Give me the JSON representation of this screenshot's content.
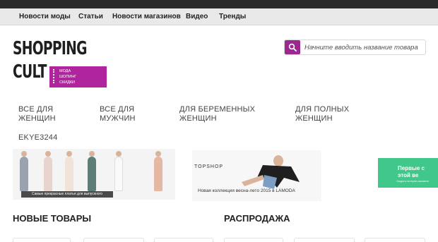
{
  "nav": {
    "items": [
      "Новости моды",
      "Статьи",
      "Новости магазинов",
      "Видео",
      "Тренды"
    ]
  },
  "logo": {
    "line1": "SHOPPING",
    "line2": "CULT",
    "tag": [
      "мода",
      "шопинг",
      "скидки"
    ],
    "accent_color": "#b0259d"
  },
  "search": {
    "placeholder": "Начните вводить название товара",
    "button_icon": "search-icon",
    "button_color": "#9b2a8f"
  },
  "categories": [
    {
      "label": "Все для женщин"
    },
    {
      "label": "Все для мужчин"
    },
    {
      "label": "Для беременных женщин"
    },
    {
      "label": "Для полных женщин"
    },
    {
      "label": "ekye3244"
    }
  ],
  "banners": {
    "b1_caption": "Самые прекрасные платья для выпускного",
    "b2_brand": "TOPSHOP",
    "b2_caption": "Новая коллекция весна-лето 2015 в LAMODA",
    "b3_line1": "Первые с",
    "b3_line2": "этой ве",
    "b3_small": "Скидки в интернет-магазине"
  },
  "sections": {
    "new_items": "Новые товары",
    "sale": "Распродажа"
  }
}
